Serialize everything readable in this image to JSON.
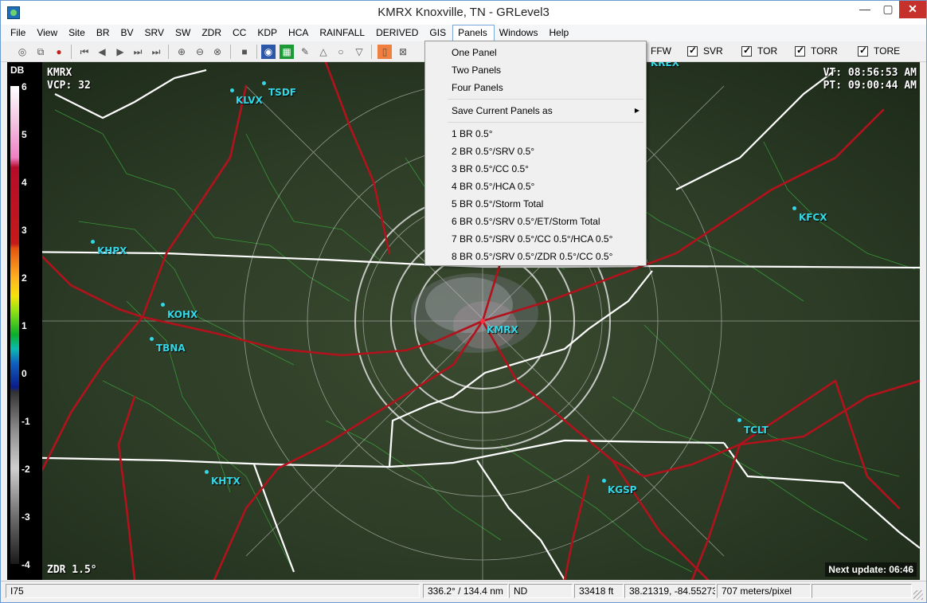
{
  "window": {
    "title": "KMRX Knoxville, TN - GRLevel3"
  },
  "menus": [
    "File",
    "View",
    "Site",
    "BR",
    "BV",
    "SRV",
    "SW",
    "ZDR",
    "CC",
    "KDP",
    "HCA",
    "RAINFALL",
    "DERIVED",
    "GIS",
    "Panels",
    "Windows",
    "Help"
  ],
  "toolbar": {
    "warnings": [
      "FFW",
      "SVR",
      "TOR",
      "TORR",
      "TORE"
    ]
  },
  "panels_menu": {
    "items": [
      "One Panel",
      "Two Panels",
      "Four Panels"
    ],
    "save_item": "Save Current Panels as",
    "presets": [
      "1 BR 0.5°",
      "2 BR 0.5°/SRV 0.5°",
      "3 BR 0.5°/CC 0.5°",
      "4 BR 0.5°/HCA 0.5°",
      "5 BR 0.5°/Storm Total",
      "6 BR 0.5°/SRV 0.5°/ET/Storm Total",
      "7 BR 0.5°/SRV 0.5°/CC 0.5°/HCA 0.5°",
      "8 BR 0.5°/SRV 0.5°/ZDR 0.5°/CC 0.5°"
    ]
  },
  "colorbar": {
    "unit": "DB",
    "ticks": [
      "6",
      "5",
      "4",
      "3",
      "2",
      "1",
      "0",
      "-1",
      "-2",
      "-3",
      "-4"
    ]
  },
  "map": {
    "site": "KMRX",
    "vcp": "VCP: 32",
    "vt": "VT: 08:56:53 AM",
    "pt": "PT: 09:00:44 AM",
    "product": "ZDR 1.5°",
    "next_update": "Next update: 06:46",
    "sites": [
      "KLVX",
      "TSDF",
      "KHPX",
      "KOHX",
      "TBNA",
      "KMRX",
      "KFCX",
      "TCLT",
      "KHTX",
      "KGSP"
    ],
    "sites_partial": [
      "KREX"
    ]
  },
  "status": {
    "fields": [
      "I75",
      "336.2° / 134.4 nm",
      "ND",
      "33418 ft",
      "38.21319, -84.55273",
      "707 meters/pixel"
    ]
  },
  "colors": {
    "menu_active_border": "#7aa7d8",
    "site_label": "#33d7e6",
    "roads": "#b2121c",
    "county_lines": "#3aa53a",
    "state_lines": "#ffffff"
  }
}
